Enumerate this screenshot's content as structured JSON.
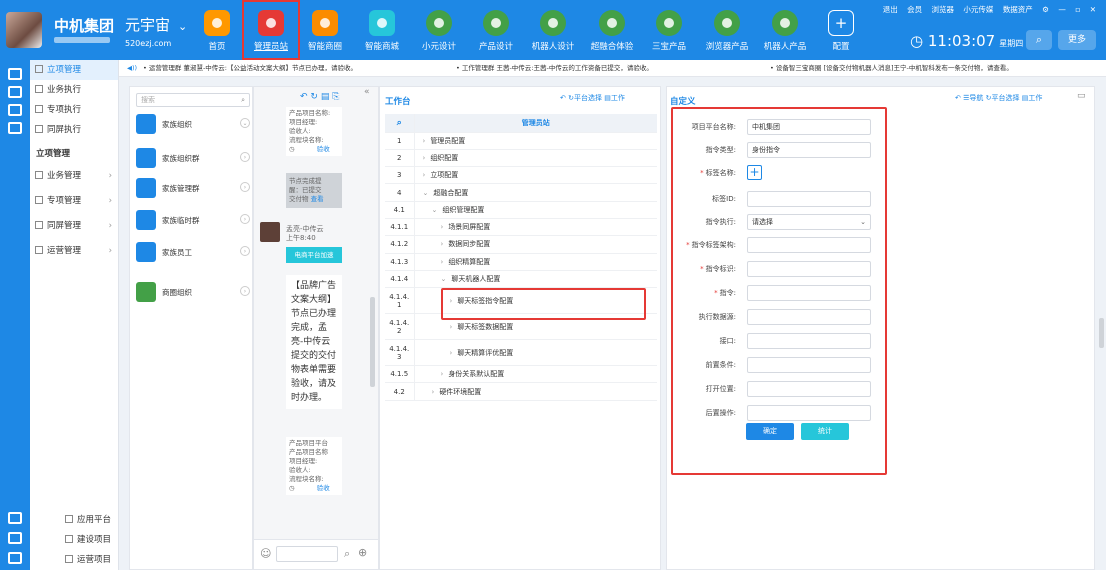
{
  "header": {
    "brand": "中机集团",
    "universe": "元宇宙",
    "universe_url": "520ezj.com",
    "clock": "11:03:07",
    "weekday": "星期四",
    "more": "更多",
    "top_links": [
      "退出",
      "会员",
      "浏览器",
      "小元传媒",
      "数据资产"
    ],
    "nav": [
      {
        "label": "首页",
        "icon": "home-icon"
      },
      {
        "label": "管理员站",
        "icon": "admin-icon"
      },
      {
        "label": "智能商圈",
        "icon": "business-circle-icon"
      },
      {
        "label": "智能商城",
        "icon": "shopping-cart-icon"
      },
      {
        "label": "小元设计",
        "icon": "globe-icon"
      },
      {
        "label": "产品设计",
        "icon": "globe-icon"
      },
      {
        "label": "机器人设计",
        "icon": "globe-icon"
      },
      {
        "label": "超融合体验",
        "icon": "globe-icon"
      },
      {
        "label": "三宝产品",
        "icon": "globe-icon"
      },
      {
        "label": "浏览器产品",
        "icon": "browser-icon"
      },
      {
        "label": "机器人产品",
        "icon": "globe-icon"
      },
      {
        "label": "配置",
        "icon": "plus-icon"
      }
    ]
  },
  "leftnav": {
    "items": [
      "立项管理",
      "业务执行",
      "专项执行",
      "同屏执行"
    ],
    "section": "立项管理",
    "sub": [
      "业务管理",
      "专项管理",
      "同屏管理",
      "运营管理"
    ],
    "bottom": [
      "应用平台",
      "建设项目",
      "运营项目"
    ]
  },
  "ticker": [
    "• 运营管理群 董淑慧-中传云:【公益活动文案大纲】节点已办理，请验收。",
    "• 工作管理群 王茜-中传云:王茜-中传云的工作资备已提交，请验收。",
    "• 设备智三宝商圈 [设备交付物机器人消息]王宁-中机智科发布一条交付物，请查看。"
  ],
  "groups": {
    "search": "搜索",
    "items": [
      "家族组织",
      "家族组织群",
      "家族管理群",
      "家族临时群",
      "家族员工",
      "商圈组织"
    ]
  },
  "chat": {
    "card1": [
      "产品项目名称:",
      "项目经理:",
      "验收人:",
      "流程块名称:"
    ],
    "card1_link": "验收",
    "grey": [
      "节点完成提",
      "醒：已提交",
      "交付物"
    ],
    "grey_link": "查看",
    "sender": "孟亮-中传云",
    "time": "上午8:40",
    "tag": "电商平台加速",
    "message": "【品牌广告文案大纲】节点已办理完成，孟亮-中传云提交的交付物表单需要验收，请及时办理。",
    "card2": [
      "产品项目平台",
      "产品项目名称",
      "项目经理:",
      "验收人:",
      "流程块名称:"
    ],
    "card2_link": "验收"
  },
  "workbench": {
    "title": "工作台",
    "tools": [
      "平台选择",
      "工作"
    ],
    "header": "管理员站",
    "rows": [
      [
        "1",
        "管理员配置",
        ">"
      ],
      [
        "2",
        "组织配置",
        ">"
      ],
      [
        "3",
        "立项配置",
        ">"
      ],
      [
        "4",
        "超融合配置",
        "v"
      ],
      [
        "4.1",
        "组织管理配置",
        "v"
      ],
      [
        "4.1.1",
        "场景同屏配置",
        ">"
      ],
      [
        "4.1.2",
        "数据同步配置",
        ">"
      ],
      [
        "4.1.3",
        "组织精算配置",
        ">"
      ],
      [
        "4.1.4",
        "聊天机器人配置",
        "v"
      ],
      [
        "4.1.4.1",
        "聊天标签指令配置",
        ">"
      ],
      [
        "4.1.4.2",
        "聊天标签数据配置",
        ">"
      ],
      [
        "4.1.4.3",
        "聊天精算评优配置",
        ">"
      ],
      [
        "4.1.5",
        "身份关系默认配置",
        ">"
      ],
      [
        "4.2",
        "硬件环境配置",
        ">"
      ]
    ]
  },
  "custom": {
    "title": "自定义",
    "tools": [
      "导航",
      "平台选择",
      "工作"
    ],
    "fields": [
      {
        "label": "项目平台名称:",
        "value": "中机集团",
        "req": false
      },
      {
        "label": "指令类型:",
        "value": "身份指令",
        "req": false
      },
      {
        "label": "标签名称:",
        "value": "",
        "req": true,
        "add": true
      },
      {
        "label": "标签ID:",
        "value": "",
        "req": false
      },
      {
        "label": "指令执行:",
        "value": "请选择",
        "req": false,
        "select": true
      },
      {
        "label": "指令标签架构:",
        "value": "",
        "req": true
      },
      {
        "label": "指令标识:",
        "value": "",
        "req": true
      },
      {
        "label": "指令:",
        "value": "",
        "req": true
      },
      {
        "label": "执行数据源:",
        "value": "",
        "req": false
      },
      {
        "label": "接口:",
        "value": "",
        "req": false
      },
      {
        "label": "前置条件:",
        "value": "",
        "req": false
      },
      {
        "label": "打开位置:",
        "value": "",
        "req": false
      },
      {
        "label": "后置操作:",
        "value": "",
        "req": false
      }
    ],
    "confirm": "确定",
    "stats": "统计"
  }
}
